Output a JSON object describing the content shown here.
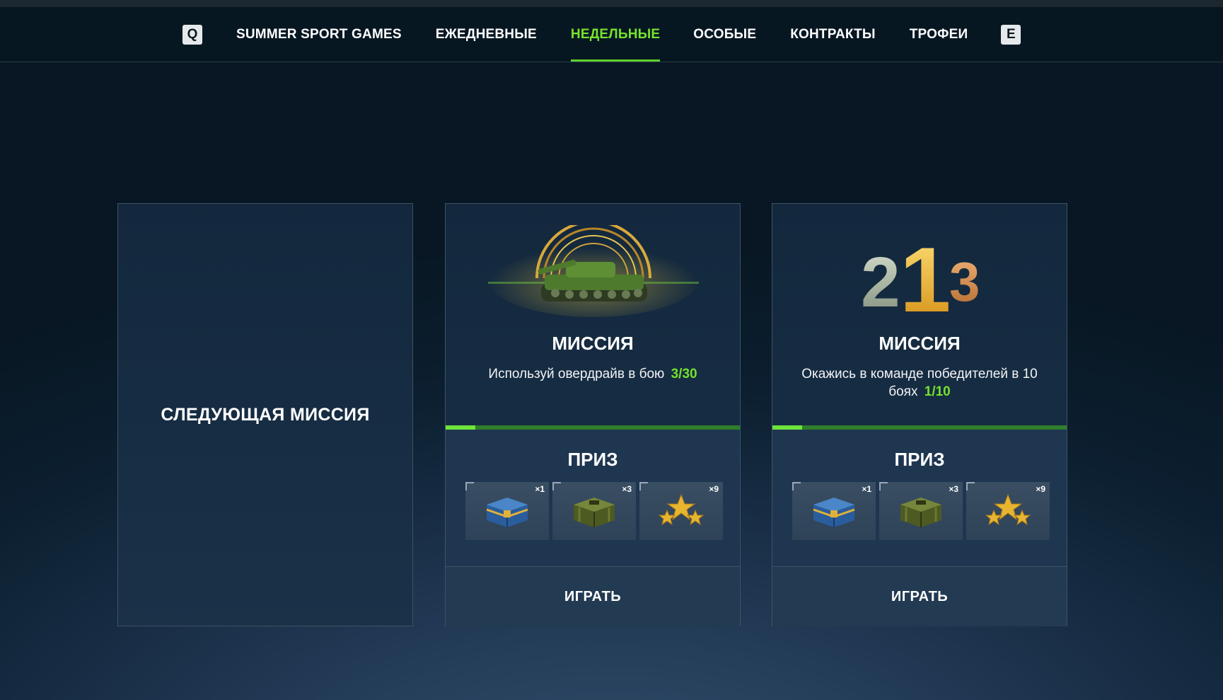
{
  "nav": {
    "prev_key": "Q",
    "next_key": "E",
    "tabs": [
      {
        "label": "SUMMER SPORT GAMES",
        "active": false
      },
      {
        "label": "ЕЖЕДНЕВНЫЕ",
        "active": false
      },
      {
        "label": "НЕДЕЛЬНЫЕ",
        "active": true
      },
      {
        "label": "ОСОБЫЕ",
        "active": false
      },
      {
        "label": "КОНТРАКТЫ",
        "active": false
      },
      {
        "label": "ТРОФЕИ",
        "active": false
      }
    ]
  },
  "next_mission": {
    "label": "СЛЕДУЮЩАЯ МИССИЯ"
  },
  "missions": [
    {
      "icon": "tank-overdrive-icon",
      "title": "МИССИЯ",
      "description": "Используй овердрайв в бою",
      "progress_text": "3/30",
      "progress_fraction": 0.1,
      "prize_title": "ПРИЗ",
      "prizes": [
        {
          "icon": "blue-container-icon",
          "qty": "×1"
        },
        {
          "icon": "green-container-icon",
          "qty": "×3"
        },
        {
          "icon": "stars-icon",
          "qty": "×9"
        }
      ],
      "play_label": "ИГРАТЬ"
    },
    {
      "icon": "podium-ranks-icon",
      "title": "МИССИЯ",
      "description": "Окажись в команде победителей в 10 боях",
      "progress_text": "1/10",
      "progress_fraction": 0.1,
      "prize_title": "ПРИЗ",
      "prizes": [
        {
          "icon": "blue-container-icon",
          "qty": "×1"
        },
        {
          "icon": "green-container-icon",
          "qty": "×3"
        },
        {
          "icon": "stars-icon",
          "qty": "×9"
        }
      ],
      "play_label": "ИГРАТЬ"
    }
  ],
  "colors": {
    "accent_green": "#74e22c",
    "progress_track": "#2f7f2c",
    "background_dark": "#081723"
  }
}
